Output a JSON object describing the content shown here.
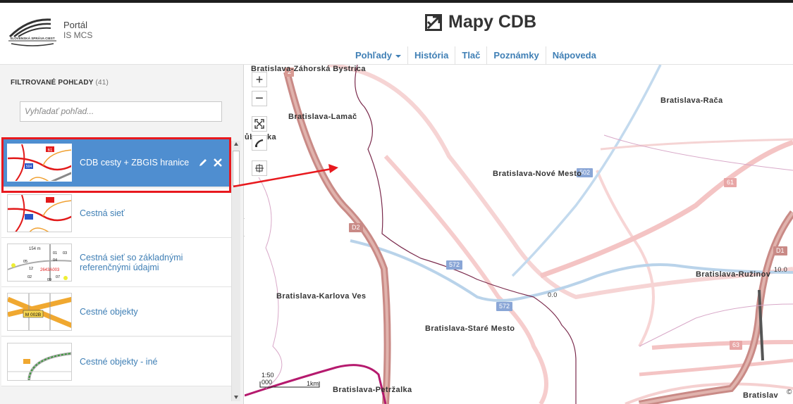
{
  "header": {
    "logo_text": "SLOVENSKÁ SPRÁVA CIEST",
    "portal_title": "Portál",
    "portal_subtitle": "IS MCS",
    "app_title": "Mapy CDB"
  },
  "nav": [
    {
      "label": "Pohľady",
      "dropdown": true
    },
    {
      "label": "História"
    },
    {
      "label": "Tlač"
    },
    {
      "label": "Poznámky"
    },
    {
      "label": "Nápoveda"
    }
  ],
  "sidebar": {
    "title": "FILTROVANÉ POHĽADY",
    "count": "(41)",
    "search_placeholder": "Vyhľadať pohľad...",
    "items": [
      {
        "label": "CDB cesty + ZBGIS hranice",
        "selected": true
      },
      {
        "label": "Cestná sieť"
      },
      {
        "label": "Cestná sieť so základnými referenčnými údajmi"
      },
      {
        "label": "Cestné objekty"
      },
      {
        "label": "Cestné objekty - iné"
      }
    ],
    "thumb_badges": {
      "road": "61",
      "small": "504",
      "obj": "M 002B",
      "ref_code": "2643A003",
      "dist": "154 m"
    },
    "ref_nodes": [
      "05",
      "12",
      "02",
      "01",
      "03",
      "04",
      "07",
      "09"
    ]
  },
  "map": {
    "places": [
      "Bratislava-Záhorská Bystrica",
      "Bratislava-Lamač",
      "Bratislava-Rača",
      "Bratislava-Nové Mesto",
      "Bratislava-Ružinov",
      "Bratislava-Karlova Ves",
      "Bratislava-Staré Mesto",
      "Bratislava-Petržalka",
      "Bratislav"
    ],
    "dubravka_fragment": "ůbravka",
    "shields": [
      "2",
      "D2",
      "502",
      "61",
      "572",
      "572",
      "D1",
      "63"
    ],
    "km_markers": [
      "0.0",
      "10.0"
    ],
    "scale_ratio": "1:50 000",
    "scale_km": "1km",
    "copyright": "©"
  },
  "colors": {
    "accent": "#3f7fb5",
    "selected": "#4f8ed0",
    "highlight_red": "#e8191e",
    "motorway": "#c98a86",
    "road_pink": "#f4c4c4",
    "road_blue": "#b9d3ea",
    "boundary": "#7a2a4c"
  }
}
